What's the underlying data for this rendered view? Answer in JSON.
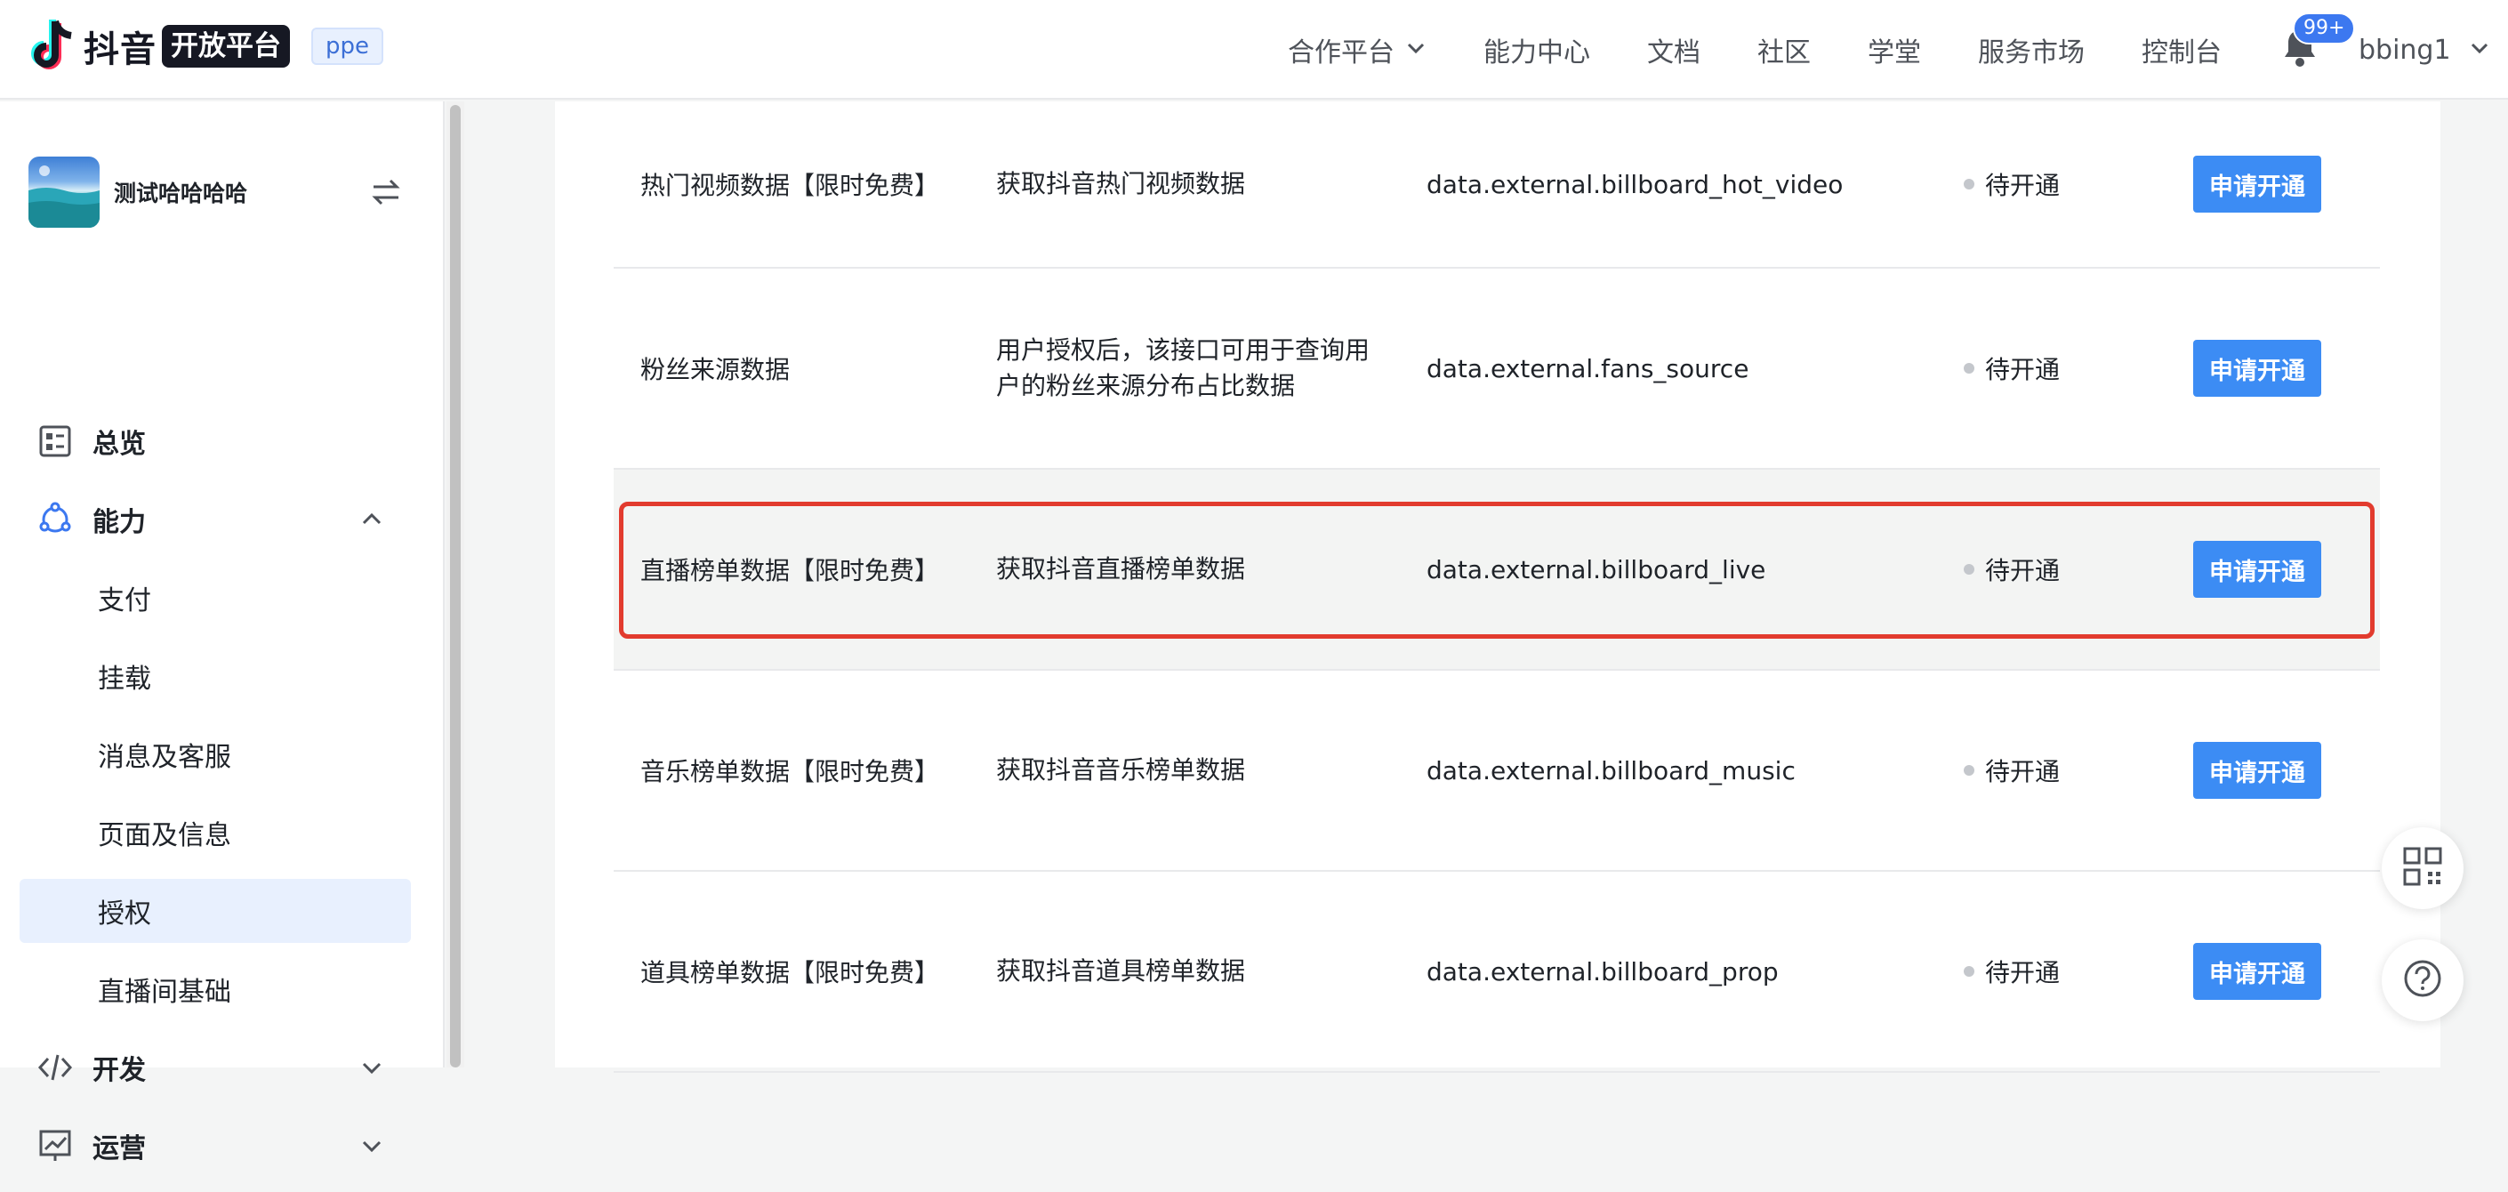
{
  "header": {
    "logo_name": "抖音",
    "logo_badge": "开放平台",
    "env_tag": "ppe",
    "nav": [
      "合作平台",
      "能力中心",
      "文档",
      "社区",
      "学堂",
      "服务市场",
      "控制台"
    ],
    "notification_count": "99+",
    "username": "bbing1"
  },
  "sidebar": {
    "app_name": "测试哈哈哈哈",
    "menu": {
      "overview": "总览",
      "capability": "能力",
      "sub_items": [
        "支付",
        "挂载",
        "消息及客服",
        "页面及信息",
        "授权",
        "直播间基础"
      ],
      "develop": "开发",
      "operate": "运营"
    }
  },
  "table": {
    "rows": [
      {
        "name": "热门视频数据【限时免费】",
        "desc": "获取抖音热门视频数据",
        "scope": "data.external.billboard_hot_video",
        "status": "待开通",
        "action": "申请开通"
      },
      {
        "name": "粉丝来源数据",
        "desc": "用户授权后，该接口可用于查询用户的粉丝来源分布占比数据",
        "scope": "data.external.fans_source",
        "status": "待开通",
        "action": "申请开通"
      },
      {
        "name": "直播榜单数据【限时免费】",
        "desc": "获取抖音直播榜单数据",
        "scope": "data.external.billboard_live",
        "status": "待开通",
        "action": "申请开通"
      },
      {
        "name": "音乐榜单数据【限时免费】",
        "desc": "获取抖音音乐榜单数据",
        "scope": "data.external.billboard_music",
        "status": "待开通",
        "action": "申请开通"
      },
      {
        "name": "道具榜单数据【限时免费】",
        "desc": "获取抖音道具榜单数据",
        "scope": "data.external.billboard_prop",
        "status": "待开通",
        "action": "申请开通"
      }
    ]
  },
  "icons": {
    "logo": "douyin-note-icon",
    "bell": "bell-icon",
    "switch": "switch-arrows-icon",
    "overview": "dashboard-icon",
    "capability": "capability-icon",
    "develop": "code-icon",
    "operate": "chart-icon",
    "qr": "qrcode-icon",
    "help": "help-icon"
  },
  "colors": {
    "primary": "#3c8cf4",
    "highlight_frame": "#e23b2e",
    "active_menu_bg": "#e8f0fe"
  }
}
